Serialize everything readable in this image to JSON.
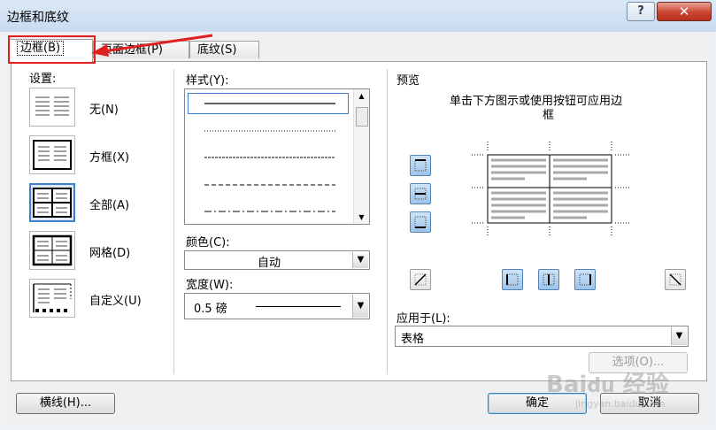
{
  "window": {
    "title": "边框和底纹",
    "help_label": "?",
    "close_label": "✕"
  },
  "tabs": [
    {
      "label": "边框(B)",
      "active": true
    },
    {
      "label": "页面边框(P)",
      "active": false
    },
    {
      "label": "底纹(S)",
      "active": false
    }
  ],
  "settings": {
    "header": "设置:",
    "items": [
      {
        "label": "无(N)",
        "icon": "border-none-icon",
        "selected": false
      },
      {
        "label": "方框(X)",
        "icon": "border-box-icon",
        "selected": false
      },
      {
        "label": "全部(A)",
        "icon": "border-all-icon",
        "selected": true
      },
      {
        "label": "网格(D)",
        "icon": "border-grid-icon",
        "selected": false
      },
      {
        "label": "自定义(U)",
        "icon": "border-custom-icon",
        "selected": false
      }
    ]
  },
  "style": {
    "header": "样式(Y):",
    "options": [
      "solid",
      "dotted",
      "fine-dashed",
      "dashed",
      "dash-dot"
    ],
    "selected": "solid"
  },
  "color": {
    "label": "颜色(C):",
    "value": "自动"
  },
  "width": {
    "label": "宽度(W):",
    "value": "0.5 磅"
  },
  "preview": {
    "header": "预览",
    "instruction_line1": "单击下方图示或使用按钮可应用边",
    "instruction_line2": "框"
  },
  "apply_to": {
    "label": "应用于(L):",
    "value": "表格"
  },
  "buttons": {
    "options": "选项(O)...",
    "horizontal_line": "横线(H)...",
    "ok": "确定",
    "cancel": "取消"
  },
  "watermark": {
    "text": "Bai",
    "text2": "经验",
    "url": "jingyan.baidu.com"
  },
  "colors": {
    "accent": "#3d7fd1",
    "highlight": "#e02020",
    "button_blue": "#9cc4ea"
  }
}
